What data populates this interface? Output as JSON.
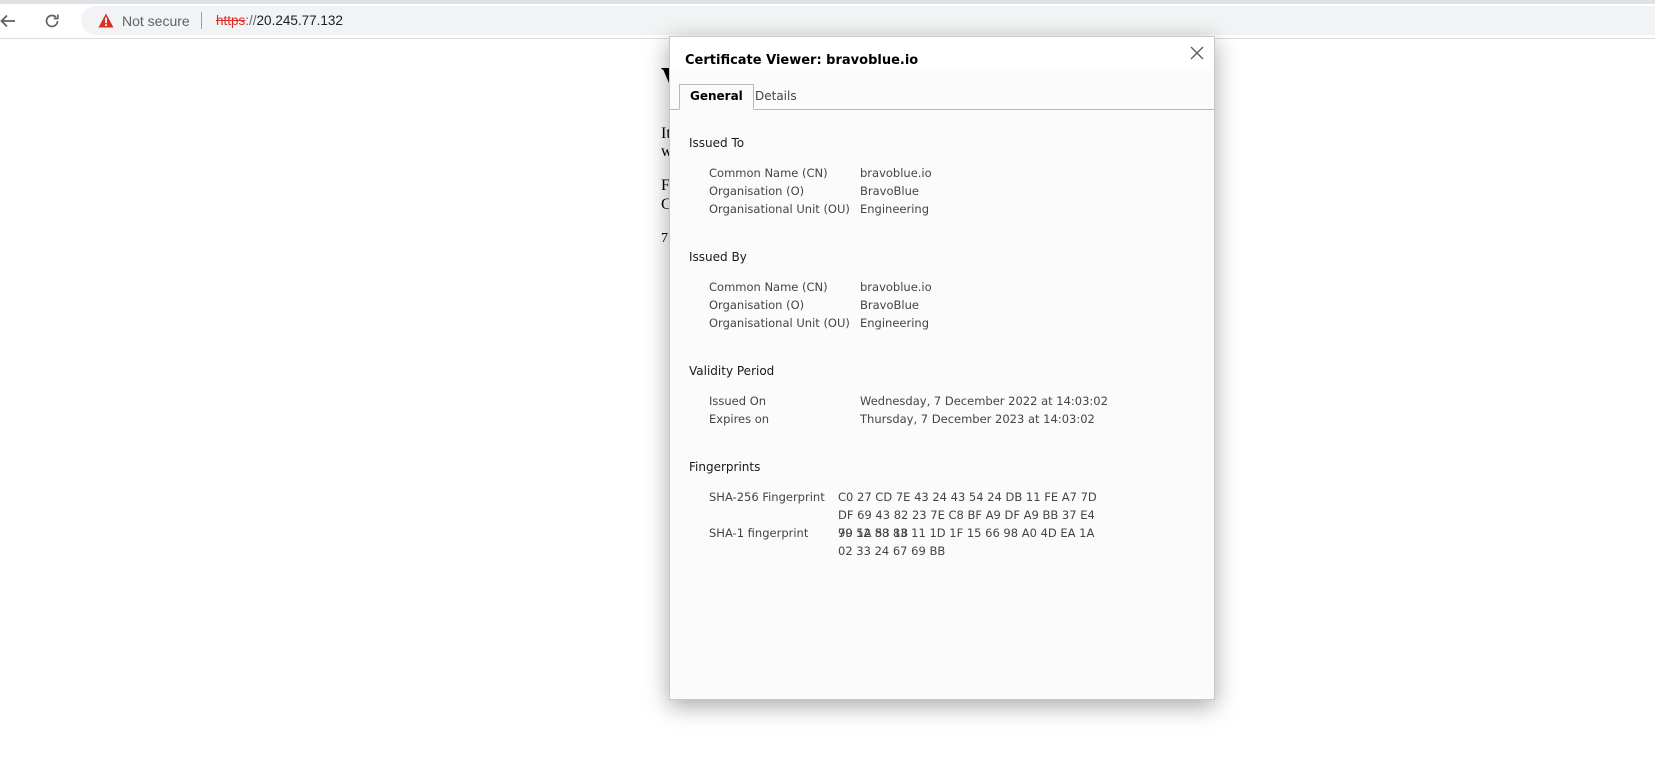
{
  "browser": {
    "security_label": "Not secure",
    "url_scheme": "https",
    "url_separator": "://",
    "url_host": "20.245.77.132"
  },
  "page": {
    "heading_partial": "V",
    "lines": [
      "It",
      "w",
      "F",
      "C",
      "7"
    ]
  },
  "dialog": {
    "title": "Certificate Viewer: bravoblue.io",
    "tabs": [
      {
        "label": "General",
        "active": true
      },
      {
        "label": "Details",
        "active": false
      }
    ],
    "issued_to": {
      "title": "Issued To",
      "rows": [
        {
          "label": "Common Name (CN)",
          "value": "bravoblue.io"
        },
        {
          "label": "Organisation (O)",
          "value": "BravoBlue"
        },
        {
          "label": "Organisational Unit (OU)",
          "value": "Engineering"
        }
      ]
    },
    "issued_by": {
      "title": "Issued By",
      "rows": [
        {
          "label": "Common Name (CN)",
          "value": "bravoblue.io"
        },
        {
          "label": "Organisation (O)",
          "value": "BravoBlue"
        },
        {
          "label": "Organisational Unit (OU)",
          "value": "Engineering"
        }
      ]
    },
    "validity": {
      "title": "Validity Period",
      "rows": [
        {
          "label": "Issued On",
          "value": "Wednesday, 7 December 2022 at 14:03:02"
        },
        {
          "label": "Expires on",
          "value": "Thursday, 7 December 2023 at 14:03:02"
        }
      ]
    },
    "fingerprints": {
      "title": "Fingerprints",
      "rows": [
        {
          "label": "SHA-256 Fingerprint",
          "value": "C0 27 CD 7E 43 24 43 54 24 DB 11 FE A7 7D DF 69 43 82 23 7E C8 BF A9 DF A9 BB 37 E4 90 1A 53 18"
        },
        {
          "label": "SHA-1 fingerprint",
          "value": "79 52 88 83 11 1D 1F 15 66 98 A0 4D EA 1A 02 33 24 67 69 BB"
        }
      ]
    }
  },
  "icons": {
    "back": "arrow-left-icon",
    "reload": "reload-icon",
    "security": "warning-triangle-icon",
    "close": "close-icon"
  },
  "colors": {
    "warning_red": "#d93025",
    "dialog_bg": "#fbfbfb"
  }
}
